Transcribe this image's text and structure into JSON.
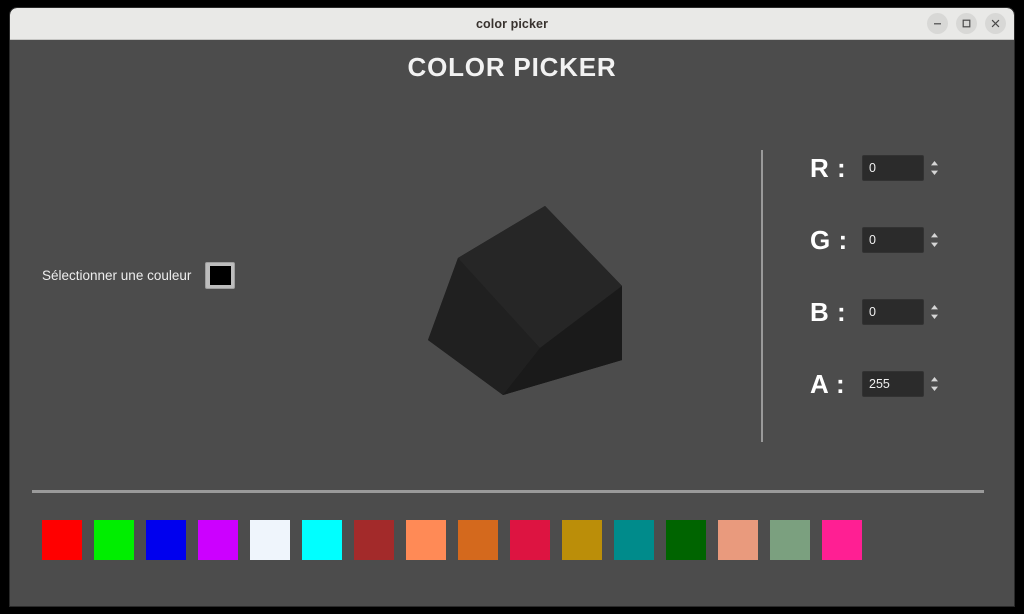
{
  "window": {
    "title": "color picker",
    "controls": [
      {
        "name": "minimize-button",
        "icon": "minimize-icon"
      },
      {
        "name": "maximize-button",
        "icon": "maximize-icon"
      },
      {
        "name": "close-button",
        "icon": "close-icon"
      }
    ]
  },
  "app": {
    "heading": "COLOR PICKER",
    "background_color": "#4c4c4c",
    "text_color": "#f2f2f2"
  },
  "picker": {
    "label": "Sélectionner une couleur",
    "swatch_color": "#000000"
  },
  "preview": {
    "shape": "cube",
    "face_colors": {
      "top": "#262626",
      "left": "#1d1d1d",
      "right": "#1a1a1a"
    }
  },
  "channels": [
    {
      "label": "R :",
      "name": "red",
      "value": "0",
      "placeholder": "0"
    },
    {
      "label": "G :",
      "name": "green",
      "value": "0",
      "placeholder": "0"
    },
    {
      "label": "B :",
      "name": "blue",
      "value": "0",
      "placeholder": "0"
    },
    {
      "label": "A :",
      "name": "alpha",
      "value": "255",
      "placeholder": "0"
    }
  ],
  "palette": {
    "colors": [
      "#ff0000",
      "#00ee00",
      "#0000ee",
      "#cc00ff",
      "#eff5fc",
      "#00ffff",
      "#a32a2a",
      "#ff8a56",
      "#d4691d",
      "#dd1441",
      "#bb8e09",
      "#008b8b",
      "#006400",
      "#e99a7d",
      "#7ba07f",
      "#ff1f93"
    ]
  }
}
